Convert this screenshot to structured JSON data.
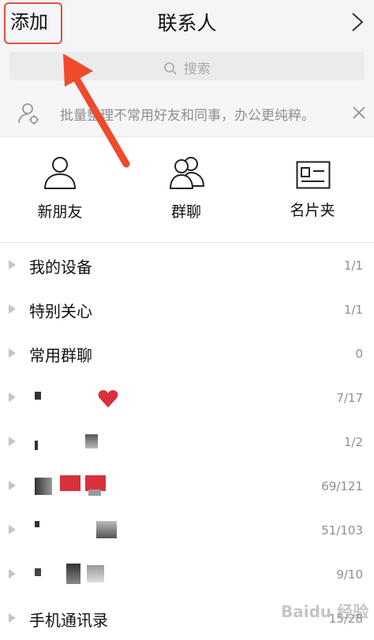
{
  "header": {
    "add_label": "添加",
    "title": "联系人"
  },
  "search": {
    "placeholder": "搜索"
  },
  "tip": {
    "text": "批量整理不常用好友和同事，办公更纯粹。"
  },
  "quick_actions": [
    {
      "label": "新朋友",
      "icon": "person-icon"
    },
    {
      "label": "群聊",
      "icon": "group-icon"
    },
    {
      "label": "名片夹",
      "icon": "card-icon"
    }
  ],
  "groups": [
    {
      "name": "我的设备",
      "count": "1/1"
    },
    {
      "name": "特别关心",
      "count": "1/1"
    },
    {
      "name": "常用群聊",
      "count": "0"
    },
    {
      "name": "",
      "count": "7/17"
    },
    {
      "name": "",
      "count": "1/2"
    },
    {
      "name": "",
      "count": "69/121"
    },
    {
      "name": "",
      "count": "51/103"
    },
    {
      "name": "",
      "count": "9/10"
    },
    {
      "name": "手机通讯录",
      "count": "15/28"
    }
  ],
  "colors": {
    "header_bg": "#f5f5f7",
    "highlight": "#e0503c",
    "secondary_text": "#8e8e93",
    "heart": "#d9313c"
  },
  "watermark": "Baidu 经验"
}
